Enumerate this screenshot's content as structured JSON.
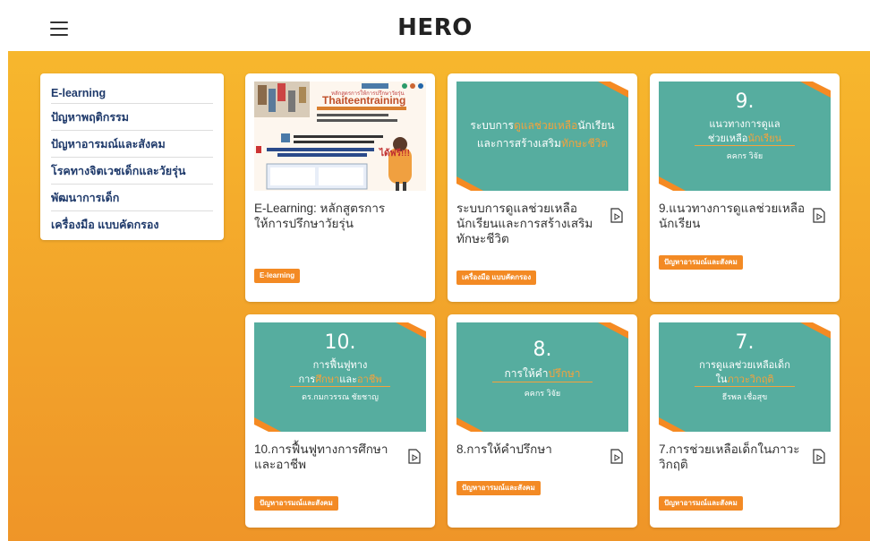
{
  "header": {
    "brand": "HERO"
  },
  "sidebar": {
    "items": [
      {
        "label": "E-learning"
      },
      {
        "label": "ปัญหาพฤติกรรม"
      },
      {
        "label": "ปัญหาอารมณ์และสังคม"
      },
      {
        "label": "โรคทางจิตเวชเด็กและวัยรุ่น"
      },
      {
        "label": "พัฒนาการเด็ก"
      },
      {
        "label": "เครื่องมือ แบบคัดกรอง"
      }
    ]
  },
  "cards": [
    {
      "title": "E-Learning: หลักสูตรการให้การปรึกษาวัยรุ่น",
      "tag": "E-learning",
      "thumb": {
        "kind": "promo",
        "line1": "หลักสูตรการให้การปรึกษาวัยรุ่น",
        "brand": "Thaiteentraining",
        "free": "ได้ฟรี!!!"
      }
    },
    {
      "title": "ระบบการดูแลช่วยเหลือนักเรียนและการสร้างเสริมทักษะชีวิต",
      "tag": "เครื่องมือ แบบคัดกรอง",
      "thumb": {
        "kind": "teal",
        "line1a": "ระบบการ",
        "line1b": "ดูแลช่วยเหลือ",
        "line1c": "นักเรียน",
        "line2a": "และการสร้างเสริม",
        "line2b": "ทักษะชีวิต"
      }
    },
    {
      "title": "9.แนวทางการดูแลช่วยเหลือนักเรียน",
      "tag": "ปัญหาอารมณ์และสังคม",
      "thumb": {
        "kind": "teal",
        "num": "9.",
        "line1": "แนวทางการดูแล",
        "line2a": "ช่วยเหลือ",
        "line2b": "นักเรียน",
        "sub": "คคกร วิจัย"
      }
    },
    {
      "title": "10.การฟื้นฟูทางการศึกษาและอาชีพ",
      "tag": "ปัญหาอารมณ์และสังคม",
      "thumb": {
        "kind": "teal",
        "num": "10.",
        "line1": "การฟื้นฟูทาง",
        "line2a": "การ",
        "line2b": "ศึกษา",
        "line2c": "และ",
        "line2d": "อาชีพ",
        "sub": "ดร.กมกวรรณ ชัยชาญ"
      }
    },
    {
      "title": "8.การให้คำปรึกษา",
      "tag": "ปัญหาอารมณ์และสังคม",
      "thumb": {
        "kind": "teal",
        "num": "8.",
        "line1a": "การให้คำ",
        "line1b": "ปรึกษา",
        "sub": "คคกร วิจัย"
      }
    },
    {
      "title": "7.การช่วยเหลือเด็กในภาวะวิกฤติ",
      "tag": "ปัญหาอารมณ์และสังคม",
      "thumb": {
        "kind": "teal",
        "num": "7.",
        "line1": "การดูแลช่วยเหลือเด็ก",
        "line2a": "ใน",
        "line2b": "ภาวะวิกฤติ",
        "sub": "ธีรพล เชื่อสุข"
      }
    }
  ],
  "colors": {
    "accent": "#f38a24",
    "teal": "#56ad9f",
    "background_top": "#f7b72d",
    "background_bottom": "#ef9528",
    "sidebar_text": "#1f3a6b"
  }
}
